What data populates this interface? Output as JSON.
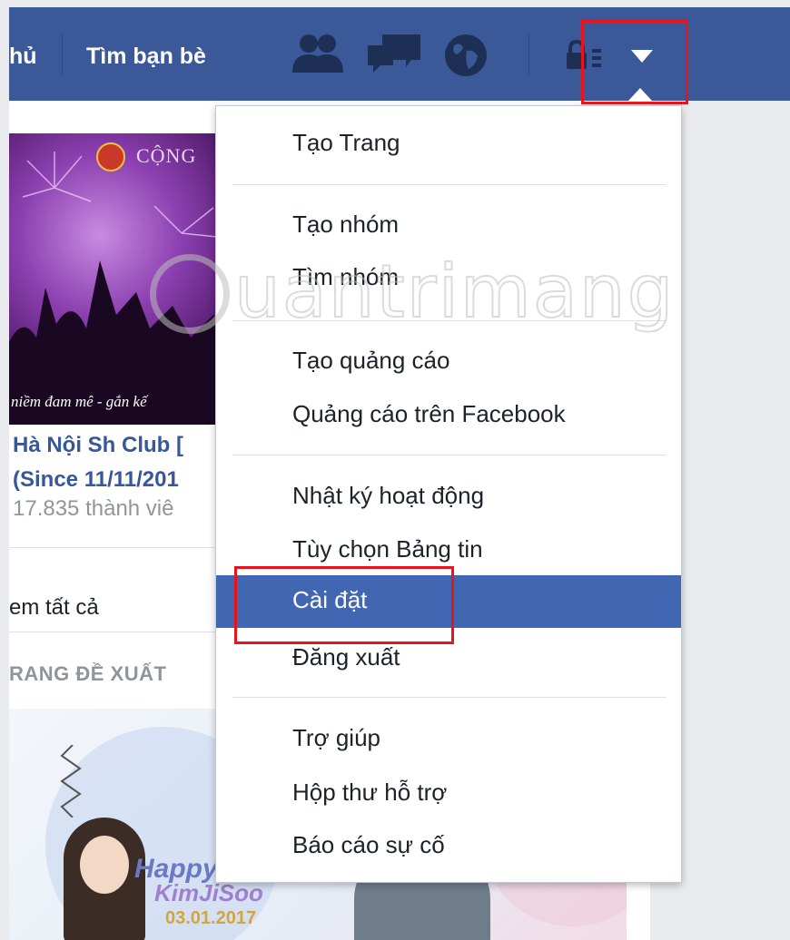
{
  "nav": {
    "home_label": "hủ",
    "find_friends_label": "Tìm bạn bè",
    "icons": [
      "friend-requests-icon",
      "messages-icon",
      "notifications-globe-icon",
      "privacy-shortcuts-icon",
      "account-menu-caret-icon"
    ]
  },
  "group": {
    "banner_brand": "CỘNG",
    "banner_script": "niềm đam mê - gắn kế",
    "title_line1": "Hà Nội Sh Club [",
    "title_line2": "(Since 11/11/201",
    "members": "17.835 thành viê"
  },
  "sidebar": {
    "see_all": "em tất cả",
    "suggested_pages_heading": "RANG ĐỀ XUẤT"
  },
  "promo": {
    "happy": "Happy",
    "name": "KimJiSoo",
    "date": "03.01.2017"
  },
  "menu": {
    "create_page": "Tạo Trang",
    "create_group": "Tạo nhóm",
    "find_groups": "Tìm nhóm",
    "create_ads": "Tạo quảng cáo",
    "ads_on_facebook": "Quảng cáo trên Facebook",
    "activity_log": "Nhật ký hoạt động",
    "news_feed_preferences": "Tùy chọn Bảng tin",
    "settings": "Cài đặt",
    "log_out": "Đăng xuất",
    "help": "Trợ giúp",
    "support_inbox": "Hộp thư hỗ trợ",
    "report_problem": "Báo cáo sự cố",
    "highlighted_item": "Cài đặt"
  },
  "watermark": {
    "text": "uantrimang"
  },
  "colors": {
    "facebook_blue": "#3b5998",
    "menu_highlight": "#4267b2",
    "annotation_red": "#e8141b",
    "link_blue": "#365899"
  }
}
